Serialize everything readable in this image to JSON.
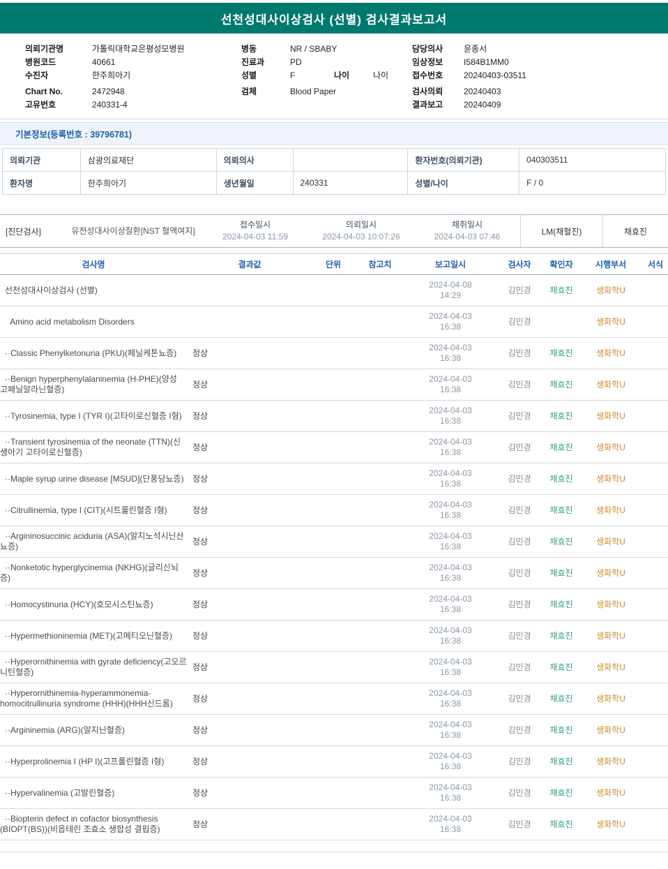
{
  "header": {
    "title": "선천성대사이상검사 (선별) 검사결과보고서"
  },
  "colors": {
    "band_teal": "#00796F",
    "header_blue": "#1E5FA9",
    "confirmer_teal": "#2f9d8e",
    "department_orange": "#cf8a2d"
  },
  "patient_header": {
    "columns": [
      {
        "items": [
          {
            "label": "의뢰기관명",
            "value": "가톨릭대학교은평성모병원"
          },
          {
            "label": "병원코드",
            "value": "40661"
          },
          {
            "label": "수진자",
            "value": "한주희아기"
          },
          {
            "label": "Chart No.",
            "value": "2472948",
            "gap": true
          },
          {
            "label": "고유번호",
            "value": "240331-4"
          }
        ]
      },
      {
        "items": [
          {
            "label": "병동",
            "value": "NR / SBABY"
          },
          {
            "label": "진료과",
            "value": "PD"
          },
          {
            "label": "성별",
            "value": "F",
            "label2": "나이",
            "value2": "나이"
          },
          {
            "label": "검체",
            "value": "Blood Paper",
            "gap": true
          }
        ]
      },
      {
        "items": [
          {
            "label": "담당의사",
            "value": "윤종서"
          },
          {
            "label": "임상정보",
            "value": "I584B1MM0"
          },
          {
            "label": "접수번호",
            "value": "20240403-03511"
          },
          {
            "label": "검사의뢰",
            "value": "20240403",
            "gap": true
          },
          {
            "label": "결과보고",
            "value": "20240409"
          }
        ]
      }
    ]
  },
  "basic_info": {
    "section_title": "기본정보(등록번호 : 39796781)",
    "rows": [
      [
        {
          "label": "의뢰기관",
          "value": "삼광의료재단"
        },
        {
          "label": "의뢰의사",
          "value": ""
        },
        {
          "label": "환자번호(의뢰기관)",
          "value": "040303511"
        }
      ],
      [
        {
          "label": "환자명",
          "value": "한주희아기"
        },
        {
          "label": "생년월일",
          "value": "240331"
        },
        {
          "label": "성별/나이",
          "value": "F / 0"
        }
      ]
    ]
  },
  "diagnostic": {
    "tag": "[진단검사]",
    "test_name": "유전성대사이상질환[NST 혈액여지]",
    "times": [
      {
        "label": "접수일시",
        "value": "2024-04-03 11:59"
      },
      {
        "label": "의뢰일시",
        "value": "2024-04-03 10:07:26"
      },
      {
        "label": "채취일시",
        "value": "2024-04-03 07:46"
      }
    ],
    "collector": "LM(채혈진)",
    "nurse": "채효진"
  },
  "results": {
    "headers": [
      "검사명",
      "결과값",
      "단위",
      "참고치",
      "보고일시",
      "검사자",
      "확인자",
      "시행부서",
      "서식"
    ],
    "rows": [
      {
        "name": "선천성대사이상검사 (선별)",
        "result": "",
        "unit": "",
        "ref": "",
        "reported": "2024-04-08 14:29",
        "tester": "김민경",
        "confirmer": "채효진",
        "dept": "생화학U",
        "form": ""
      },
      {
        "name": "Amino acid metabolism Disorders",
        "indent": true,
        "result": "",
        "unit": "",
        "ref": "",
        "reported": "2024-04-03 16:38",
        "tester": "김민경",
        "confirmer": "",
        "dept": "생화학U",
        "form": ""
      },
      {
        "name": "··Classic Phenylketonuria (PKU)(페닐케톤뇨증)",
        "result": "정상",
        "unit": "",
        "ref": "",
        "reported": "2024-04-03 16:38",
        "tester": "김민경",
        "confirmer": "채효진",
        "dept": "생화학U",
        "form": ""
      },
      {
        "name": "··Benign hyperphenylalaninemia (H-PHE)(양성 고페닐알라닌혈증)",
        "result": "정상",
        "unit": "",
        "ref": "",
        "reported": "2024-04-03 16:38",
        "tester": "김민경",
        "confirmer": "채효진",
        "dept": "생화학U",
        "form": ""
      },
      {
        "name": "··Tyrosinemia, type I (TYR I)(고타이로신혈증 I형)",
        "result": "정상",
        "unit": "",
        "ref": "",
        "reported": "2024-04-03 16:38",
        "tester": "김민경",
        "confirmer": "채효진",
        "dept": "생화학U",
        "form": ""
      },
      {
        "name": "··Transient tyrosinemia of the neonate (TTN)(신생아기 고타이로신혈증)",
        "result": "정상",
        "unit": "",
        "ref": "",
        "reported": "2024-04-03 16:38",
        "tester": "김민경",
        "confirmer": "채효진",
        "dept": "생화학U",
        "form": ""
      },
      {
        "name": "··Maple syrup urine disease [MSUD](단풍당뇨증)",
        "result": "정상",
        "unit": "",
        "ref": "",
        "reported": "2024-04-03 16:38",
        "tester": "김민경",
        "confirmer": "채효진",
        "dept": "생화학U",
        "form": ""
      },
      {
        "name": "··Citrullinemia, type I (CIT)(시트룰린혈증 I형)",
        "result": "정상",
        "unit": "",
        "ref": "",
        "reported": "2024-04-03 16:38",
        "tester": "김민경",
        "confirmer": "채효진",
        "dept": "생화학U",
        "form": ""
      },
      {
        "name": "··Argininosuccinic aciduria (ASA)(알지노석시닌산뇨증)",
        "result": "정상",
        "unit": "",
        "ref": "",
        "reported": "2024-04-03 16:38",
        "tester": "김민경",
        "confirmer": "채효진",
        "dept": "생화학U",
        "form": ""
      },
      {
        "name": "··Nonketotic hyperglycinemia (NKHG)(글리신뇌증)",
        "result": "정상",
        "unit": "",
        "ref": "",
        "reported": "2024-04-03 16:38",
        "tester": "김민경",
        "confirmer": "채효진",
        "dept": "생화학U",
        "form": ""
      },
      {
        "name": "··Homocystinuria (HCY)(호모시스틴뇨증)",
        "result": "정상",
        "unit": "",
        "ref": "",
        "reported": "2024-04-03 16:38",
        "tester": "김민경",
        "confirmer": "채효진",
        "dept": "생화학U",
        "form": ""
      },
      {
        "name": "··Hypermethioninemia (MET)(고메티오닌혈증)",
        "result": "정상",
        "unit": "",
        "ref": "",
        "reported": "2024-04-03 16:38",
        "tester": "김민경",
        "confirmer": "채효진",
        "dept": "생화학U",
        "form": ""
      },
      {
        "name": "··Hyperornithinemia with gyrate deficiency(고오르니틴혈증)",
        "result": "정상",
        "unit": "",
        "ref": "",
        "reported": "2024-04-03 16:38",
        "tester": "김민경",
        "confirmer": "채효진",
        "dept": "생화학U",
        "form": ""
      },
      {
        "name": "··Hyperornithinemia-hyperammonemia-homocitrullinuria syndrome (HHH)(HHH신드롬)",
        "result": "정상",
        "unit": "",
        "ref": "",
        "reported": "2024-04-03 16:38",
        "tester": "김민경",
        "confirmer": "채효진",
        "dept": "생화학U",
        "form": ""
      },
      {
        "name": "··Argininemia (ARG)(알지닌혈증)",
        "result": "정상",
        "unit": "",
        "ref": "",
        "reported": "2024-04-03 16:38",
        "tester": "김민경",
        "confirmer": "채효진",
        "dept": "생화학U",
        "form": ""
      },
      {
        "name": "··Hyperprolinemia I (HP I)(고프롤린혈증 I형)",
        "result": "정상",
        "unit": "",
        "ref": "",
        "reported": "2024-04-03 16:38",
        "tester": "김민경",
        "confirmer": "채효진",
        "dept": "생화학U",
        "form": ""
      },
      {
        "name": "··Hypervalinemia (고발린혈증)",
        "result": "정상",
        "unit": "",
        "ref": "",
        "reported": "2024-04-03 16:38",
        "tester": "김민경",
        "confirmer": "채효진",
        "dept": "생화학U",
        "form": ""
      },
      {
        "name": "··Biopterin defect in cofactor biosynthesis (BIOPT(BS))(비옵테린 조효소 생합성 결핍증)",
        "result": "정상",
        "unit": "",
        "ref": "",
        "reported": "2024-04-03 16:38",
        "tester": "김민경",
        "confirmer": "채효진",
        "dept": "생화학U",
        "form": ""
      }
    ]
  }
}
